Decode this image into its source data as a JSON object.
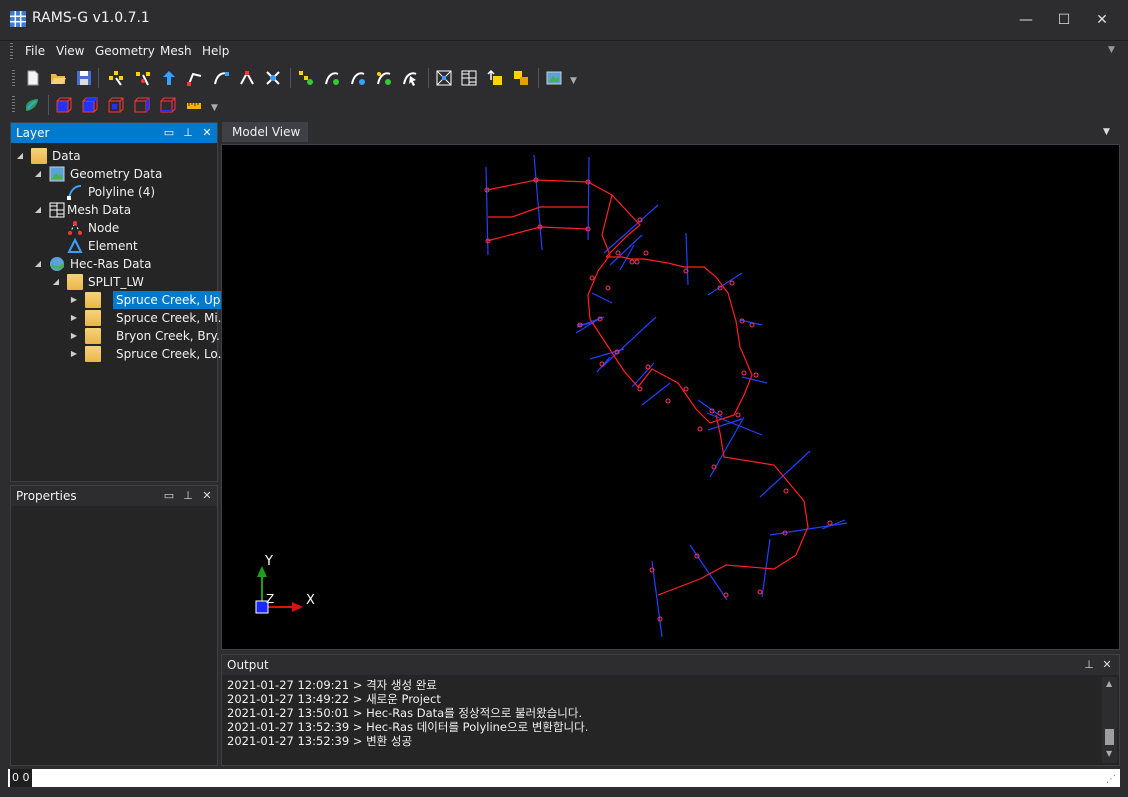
{
  "window": {
    "title": "RAMS-G v1.0.7.1",
    "minimize": "—",
    "maximize": "☐",
    "close": "✕"
  },
  "menu": [
    "File",
    "View",
    "Geometry",
    "Mesh",
    "Help"
  ],
  "layer_panel": {
    "title": "Layer",
    "tree": {
      "data": "Data",
      "geometry_data": "Geometry Data",
      "polyline": "Polyline (4)",
      "mesh_data": "Mesh Data",
      "node": "Node",
      "element": "Element",
      "hecras_data": "Hec-Ras Data",
      "split": "SPLIT_LW",
      "items": [
        "Spruce Creek, Up...",
        "Spruce Creek, Mi...",
        "Bryon Creek, Bry...",
        "Spruce Creek, Lo..."
      ]
    }
  },
  "properties_panel": {
    "title": "Properties"
  },
  "model_view": {
    "tab": "Model View",
    "axis_y": "Y",
    "axis_z": "Z",
    "axis_x": "X"
  },
  "output_panel": {
    "title": "Output",
    "lines": [
      "2021-01-27 12:09:21 > 격자 생성 완료",
      "2021-01-27 13:49:22 > 새로운 Project",
      "2021-01-27 13:50:01 > Hec-Ras Data를 정상적으로 불러왔습니다.",
      "2021-01-27 13:52:39 > Hec-Ras 데이터를 Polyline으로 변환합니다.",
      "2021-01-27 13:52:39 > 변환 성공"
    ]
  },
  "status": {
    "coords": "0 0"
  },
  "colors": {
    "accent": "#007acc",
    "river": "#ff2020",
    "section": "#2040ff"
  }
}
